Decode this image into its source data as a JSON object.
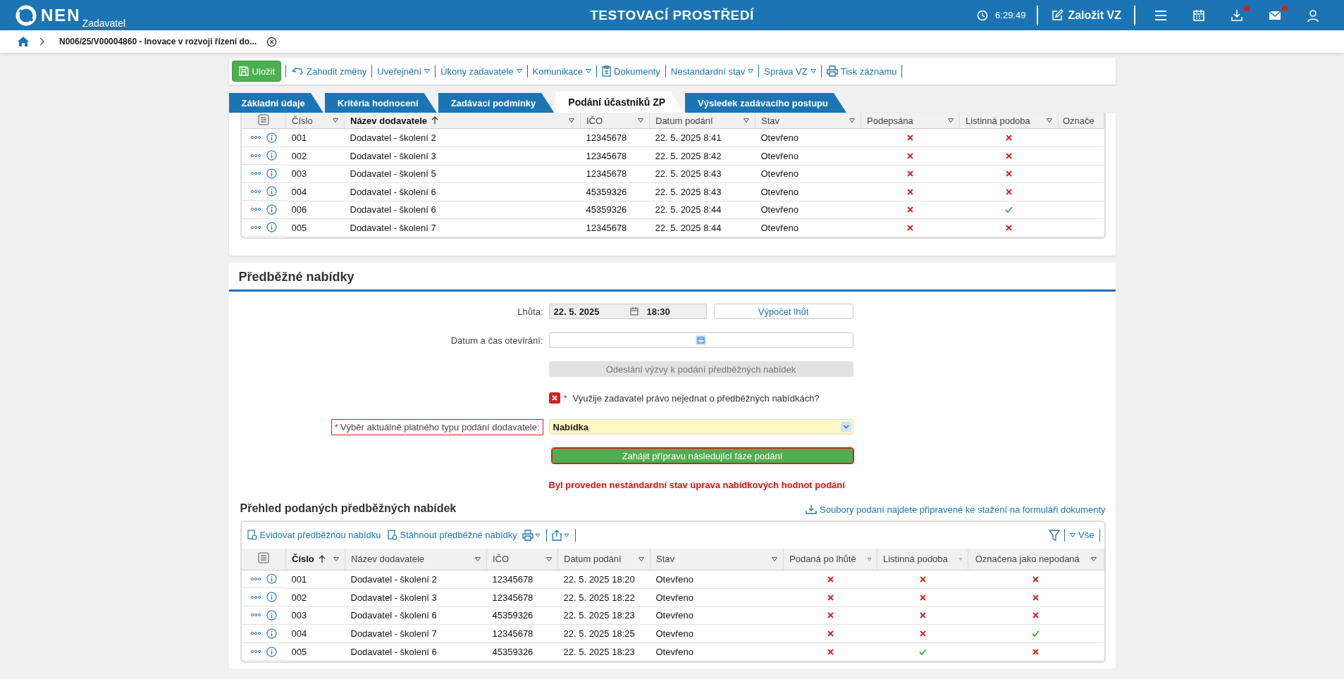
{
  "header": {
    "logo": "NEN",
    "logo_sub": "Zadavatel",
    "title": "TESTOVACÍ PROSTŘEDÍ",
    "time": "6:29:49",
    "create_button": "Založit VZ",
    "icons": [
      {
        "kind": "menu",
        "badge": false
      },
      {
        "kind": "calendar",
        "badge": false
      },
      {
        "kind": "download",
        "badge": true
      },
      {
        "kind": "mail",
        "badge": true
      },
      {
        "kind": "user",
        "badge": false
      }
    ]
  },
  "breadcrumb": {
    "title": "N006/25/V00004860 - Inovace v rozvoji řízení do..."
  },
  "toolbar": [
    {
      "kind": "save",
      "label": "Uložit",
      "dropdown": false
    },
    {
      "kind": "undo",
      "label": "Zahodit změny",
      "dropdown": false
    },
    {
      "kind": "text",
      "label": "Uveřejnění",
      "dropdown": true
    },
    {
      "kind": "text",
      "label": "Úkony zadavatele",
      "dropdown": true
    },
    {
      "kind": "text",
      "label": "Komunikace",
      "dropdown": true
    },
    {
      "kind": "document",
      "label": "Dokumenty",
      "dropdown": false
    },
    {
      "kind": "text",
      "label": "Nestandardní stav",
      "dropdown": true
    },
    {
      "kind": "text",
      "label": "Správa VZ",
      "dropdown": true
    },
    {
      "kind": "print",
      "label": "Tisk záznamu",
      "dropdown": false
    }
  ],
  "tabs": [
    {
      "label": "Základní údaje",
      "selected": false
    },
    {
      "label": "Kritéria hodnocení",
      "selected": false
    },
    {
      "label": "Zadávací podmínky",
      "selected": false
    },
    {
      "label": "Podání účastníků ZP",
      "selected": true
    },
    {
      "label": "Výsledek zadávacího postupu",
      "selected": false
    }
  ],
  "submissions_table": {
    "columns": [
      {
        "label": "Číslo",
        "sorted": false,
        "filter": true
      },
      {
        "label": "Název dodavatele",
        "sorted": true,
        "filter": true
      },
      {
        "label": "IČO",
        "sorted": false,
        "filter": true
      },
      {
        "label": "Datum podání",
        "sorted": false,
        "filter": true
      },
      {
        "label": "Stav",
        "sorted": false,
        "filter": true
      },
      {
        "label": "Podepsána",
        "sorted": false,
        "filter": true
      },
      {
        "label": "Listinná podoba",
        "sorted": false,
        "filter": true
      },
      {
        "label": "Označe",
        "sorted": false,
        "filter": false
      }
    ],
    "rows": [
      {
        "number": "001",
        "supplier": "Dodavatel - školení 2",
        "ico": "12345678",
        "date": "22. 5. 2025 8:41",
        "status": "Otevřeno",
        "signed": false,
        "paper": false
      },
      {
        "number": "002",
        "supplier": "Dodavatel - školení 3",
        "ico": "12345678",
        "date": "22. 5. 2025 8:42",
        "status": "Otevřeno",
        "signed": false,
        "paper": false
      },
      {
        "number": "003",
        "supplier": "Dodavatel - školení 5",
        "ico": "12345678",
        "date": "22. 5. 2025 8:43",
        "status": "Otevřeno",
        "signed": false,
        "paper": false
      },
      {
        "number": "004",
        "supplier": "Dodavatel - školení 6",
        "ico": "45359326",
        "date": "22. 5. 2025 8:43",
        "status": "Otevřeno",
        "signed": false,
        "paper": false
      },
      {
        "number": "006",
        "supplier": "Dodavatel - školení 6",
        "ico": "45359326",
        "date": "22. 5. 2025 8:44",
        "status": "Otevřeno",
        "signed": false,
        "paper": true
      },
      {
        "number": "005",
        "supplier": "Dodavatel - školení 7",
        "ico": "12345678",
        "date": "22. 5. 2025 8:44",
        "status": "Otevřeno",
        "signed": false,
        "paper": false
      }
    ]
  },
  "preliminary": {
    "title": "Předběžné nabídky",
    "deadline": {
      "label": "Lhůta:",
      "date": "22. 5. 2025",
      "time": "18:30",
      "button": "Výpočet lhůt"
    },
    "opening": {
      "label": "Datum a čas otevírání:"
    },
    "send_button": {
      "label": "Odeslání výzvy k podání předběžných nabídek",
      "disabled": true
    },
    "waive": {
      "label": "Využije zadavatel právo nejednat o předběžných nabídkách?",
      "required_mark": "*",
      "checked": false
    },
    "type_select": {
      "label": "Výběr aktuálně platného typu podání dodavatele:",
      "required_mark": "*",
      "value": "Nabídka"
    },
    "start_button": "Zahájit přípravu následující fáze podání",
    "warning": "Byl proveden nestandardní stav úprava nabídkových hodnot podání"
  },
  "overview": {
    "title": "Přehled podaných předběžných nabídek",
    "download_link": "Soubory podaní najdete připravené ke stažení na formuláři dokumenty",
    "actions": [
      "Evidovat předběžnou nabídku",
      "Stáhnout předběžné nabídky"
    ],
    "filter_label": "Vše",
    "columns": [
      {
        "label": "Číslo",
        "sorted": true
      },
      {
        "label": "Název dodavatele",
        "sorted": false
      },
      {
        "label": "IČO",
        "sorted": false
      },
      {
        "label": "Datum podání",
        "sorted": false
      },
      {
        "label": "Stav",
        "sorted": false
      },
      {
        "label": "Podaná po lhůtě",
        "sorted": false
      },
      {
        "label": "Listinná podoba",
        "sorted": false
      },
      {
        "label": "Označena jako nepodaná",
        "sorted": false
      }
    ],
    "rows": [
      {
        "number": "001",
        "supplier": "Dodavatel - školení 2",
        "ico": "12345678",
        "date": "22. 5. 2025 18:20",
        "status": "Otevřeno",
        "late": false,
        "paper": false,
        "unsubmitted": false
      },
      {
        "number": "002",
        "supplier": "Dodavatel - školení 3",
        "ico": "12345678",
        "date": "22. 5. 2025 18:22",
        "status": "Otevřeno",
        "late": false,
        "paper": false,
        "unsubmitted": false
      },
      {
        "number": "003",
        "supplier": "Dodavatel - školení 6",
        "ico": "45359326",
        "date": "22. 5. 2025 18:23",
        "status": "Otevřeno",
        "late": false,
        "paper": false,
        "unsubmitted": false
      },
      {
        "number": "004",
        "supplier": "Dodavatel - školení 7",
        "ico": "12345678",
        "date": "22. 5. 2025 18:25",
        "status": "Otevřeno",
        "late": false,
        "paper": false,
        "unsubmitted": true
      },
      {
        "number": "005",
        "supplier": "Dodavatel - školení 6",
        "ico": "45359326",
        "date": "22. 5. 2025 18:23",
        "status": "Otevřeno",
        "late": false,
        "paper": true,
        "unsubmitted": false
      }
    ]
  }
}
